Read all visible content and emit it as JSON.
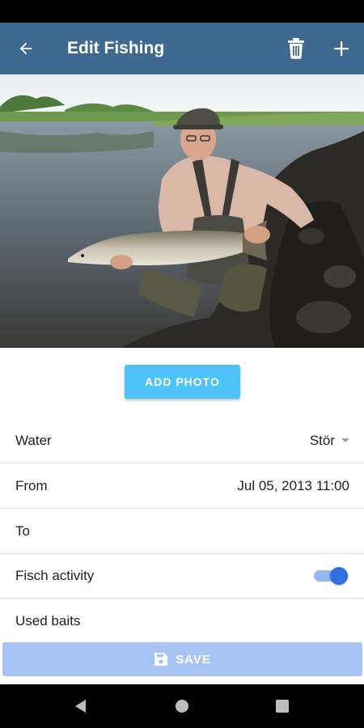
{
  "app_bar": {
    "title": "Edit Fishing",
    "back_icon": "arrow-left-icon",
    "delete_icon": "trash-icon",
    "add_icon": "plus-icon",
    "background": "#3e6a92"
  },
  "photo": {
    "add_photo_label": "ADD PHOTO",
    "button_color": "#4fc3f7"
  },
  "form": {
    "water_label": "Water",
    "water_value": "Stör",
    "from_label": "From",
    "from_value": "Jul 05, 2013 11:00",
    "to_label": "To",
    "to_value": "",
    "fish_activity_label": "Fisch activity",
    "fish_activity_on": true,
    "used_baits_label": "Used baits"
  },
  "save": {
    "label": "SAVE",
    "icon": "floppy-disk-icon",
    "color": "#a7c4f4"
  },
  "system_nav": {
    "back_icon": "triangle-back-icon",
    "home_icon": "circle-home-icon",
    "recents_icon": "square-recents-icon"
  }
}
